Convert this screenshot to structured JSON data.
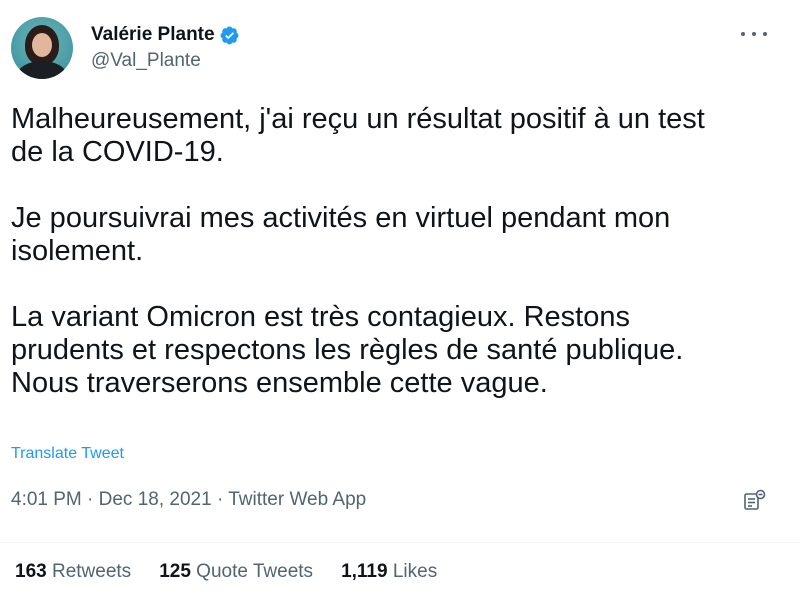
{
  "author": {
    "name": "Valérie Plante",
    "handle": "@Val_Plante",
    "verified": true
  },
  "tweet": {
    "text": "Malheureusement, j'ai reçu un résultat positif à un test\nde la COVID-19.\n\nJe poursuivrai mes activités en virtuel pendant mon\nisolement.\n\nLa variant Omicron est très contagieux. Restons\nprudents et respectons les règles de santé publique.\nNous traverserons ensemble cette vague.",
    "translate_label": "Translate Tweet",
    "meta": "4:01 PM · Dec 18, 2021 · Twitter Web App"
  },
  "stats": [
    {
      "count": "163",
      "label": "Retweets"
    },
    {
      "count": "125",
      "label": "Quote Tweets"
    },
    {
      "count": "1,119",
      "label": "Likes"
    }
  ],
  "colors": {
    "accent": "#1d9bf0",
    "text": "#0f1419",
    "secondary": "#536471"
  },
  "icons": [
    "avatar",
    "verified-badge-icon",
    "more-options-icon",
    "analytics-icon"
  ]
}
